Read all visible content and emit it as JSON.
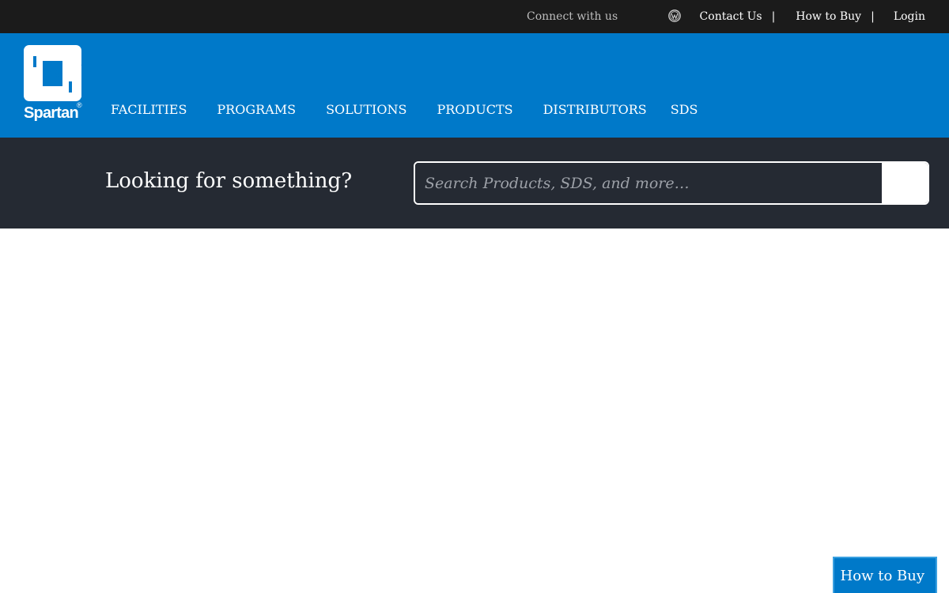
{
  "topbar": {
    "connect_label": "Connect with us",
    "social_icon": "wordpress-icon",
    "links": [
      "Contact Us",
      "How to Buy",
      "Login"
    ],
    "separator": "|"
  },
  "brand": {
    "name": "Spartan",
    "registered_mark": "®",
    "color": "#0079c9"
  },
  "nav": {
    "items": [
      "FACILITIES",
      "PROGRAMS",
      "SOLUTIONS",
      "PRODUCTS",
      "DISTRIBUTORS",
      "SDS"
    ]
  },
  "search": {
    "prompt": "Looking for something?",
    "placeholder": "Search Products, SDS, and more…",
    "value": ""
  },
  "floating": {
    "how_to_buy": "How to Buy"
  }
}
